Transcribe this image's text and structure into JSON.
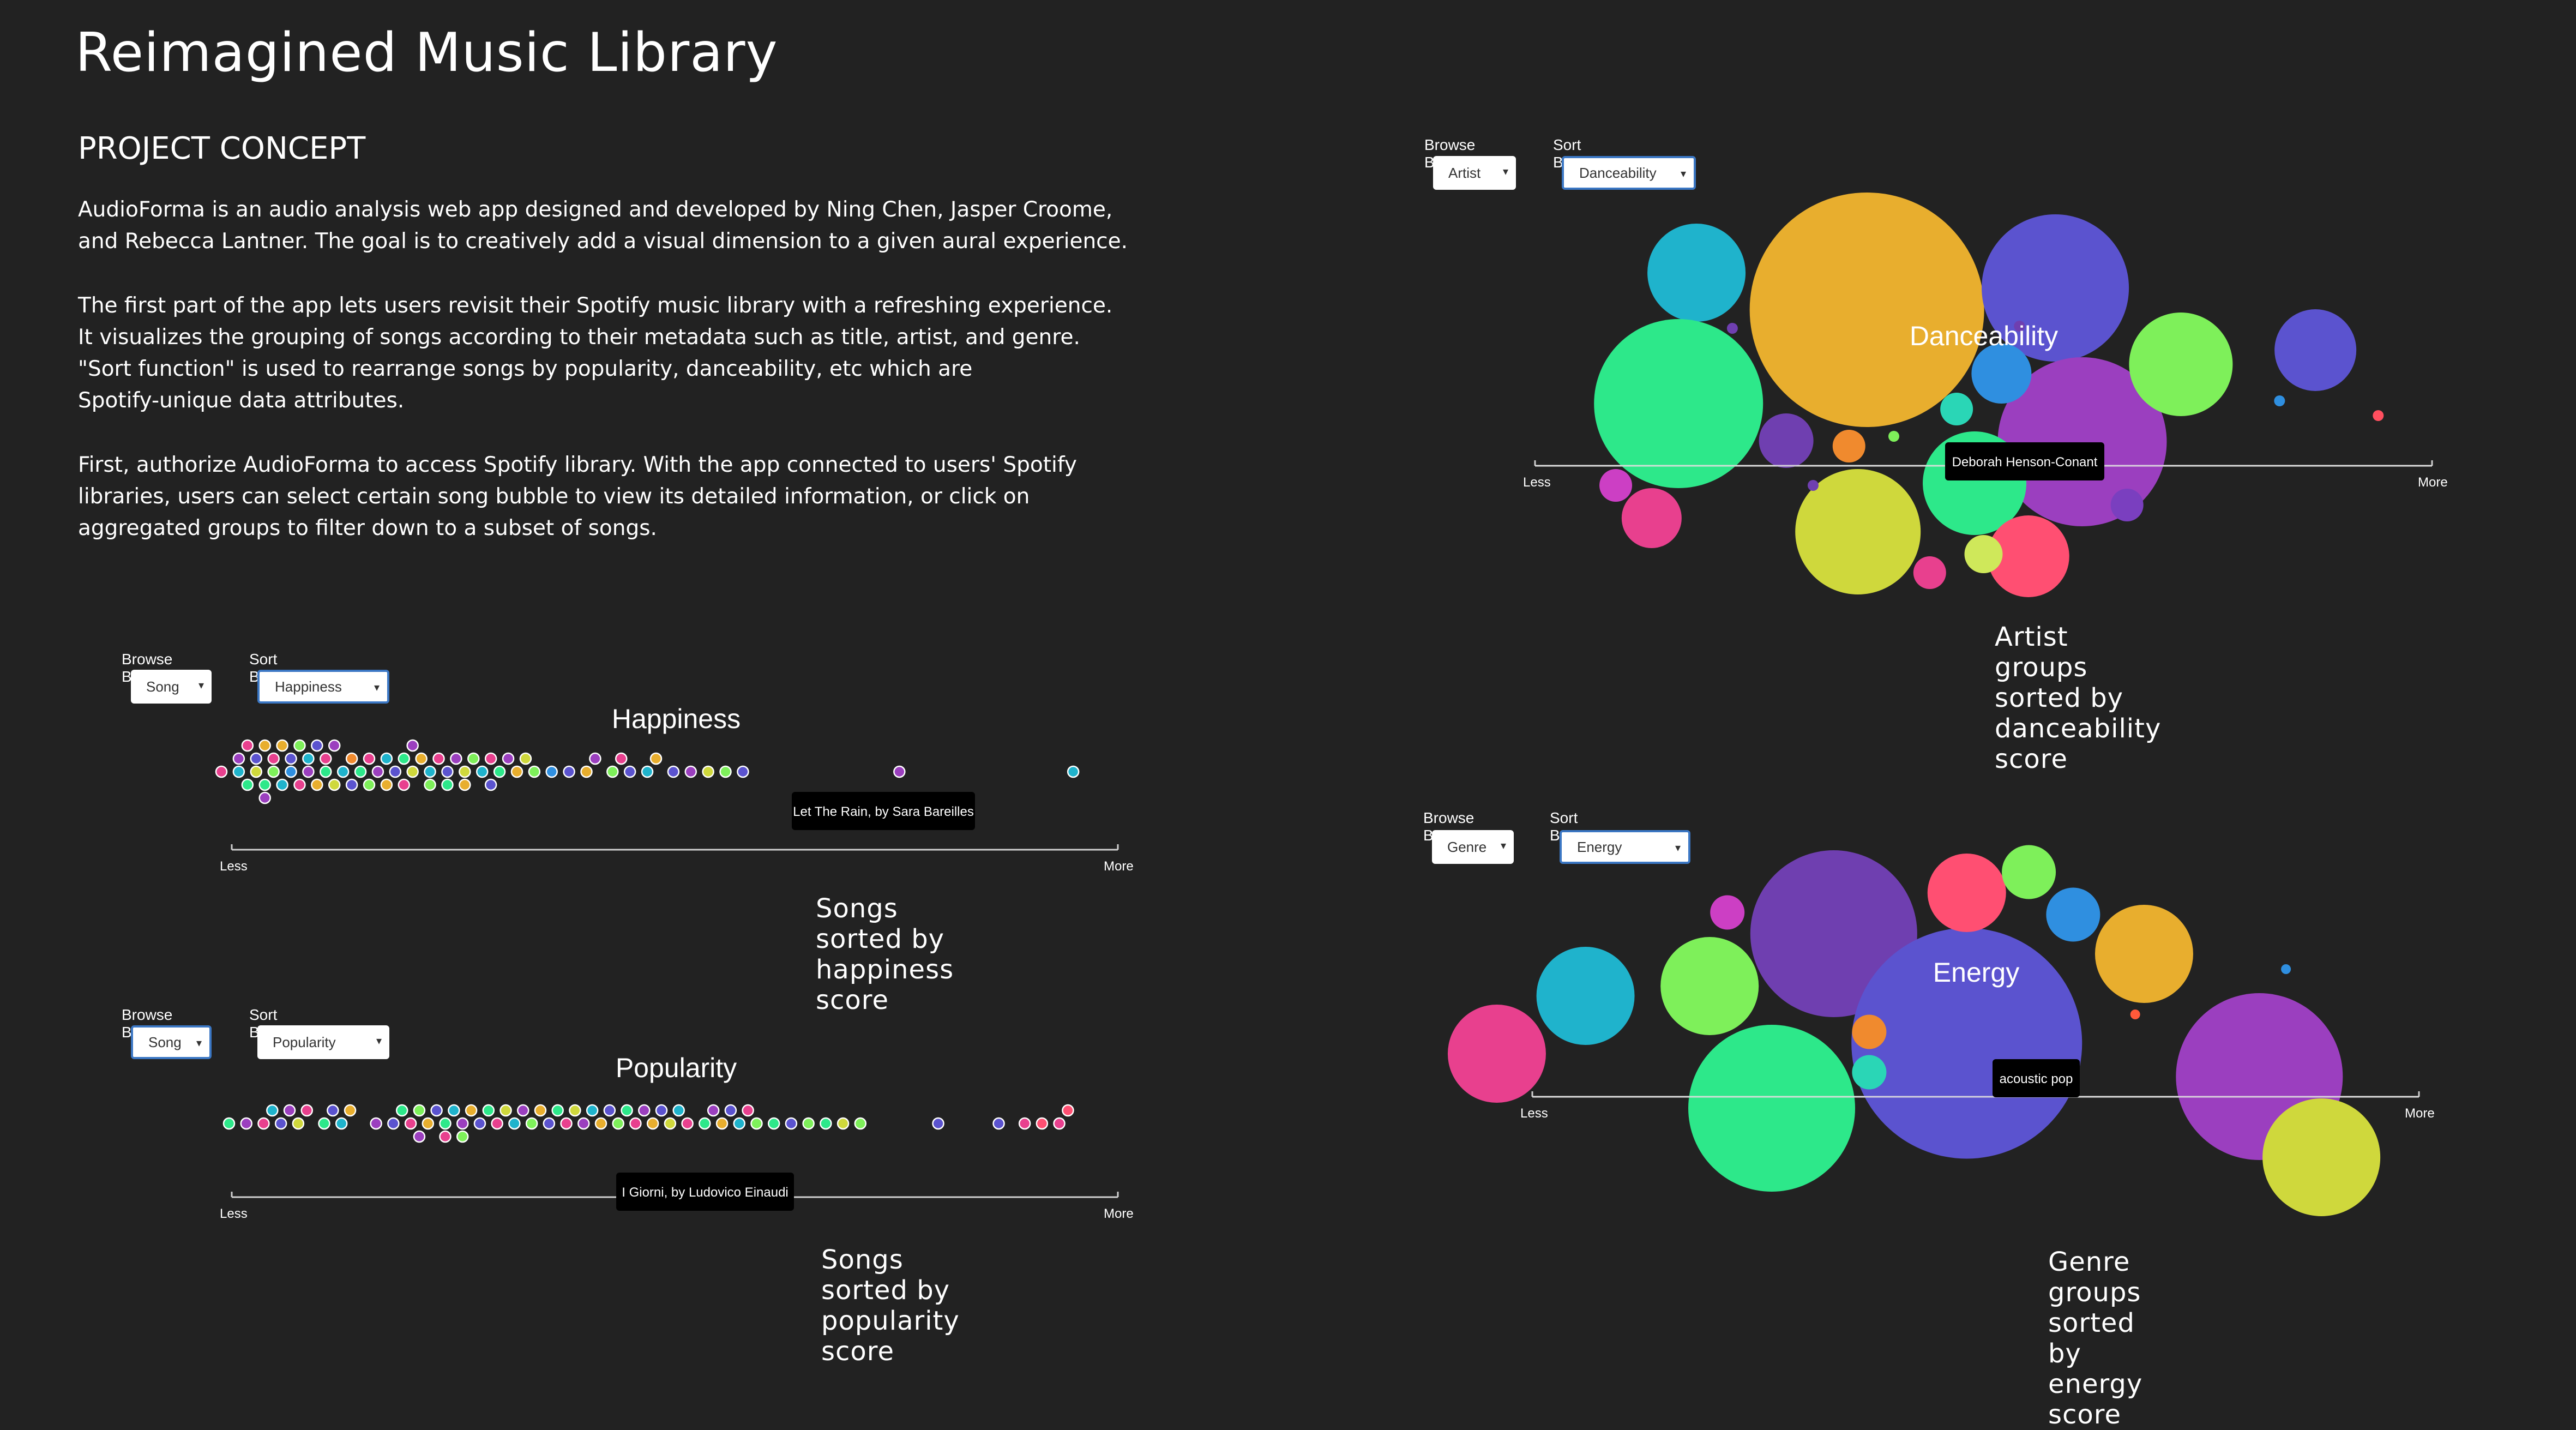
{
  "page": {
    "title": "Reimagined Music Library",
    "concept_heading": "PROJECT CONCEPT",
    "paragraphs": [
      [
        "AudioForma is an audio analysis web app designed and developed by Ning Chen, Jasper Croome,",
        "and Rebecca Lantner. The goal is to creatively add a visual dimension to a given aural experience."
      ],
      [
        "The first part of the app lets users revisit their Spotify music library with a refreshing experience.",
        "It visualizes the grouping of songs according to their metadata such as title, artist, and genre.",
        "\"Sort function\" is used to rearrange songs by popularity, danceability, etc which are",
        "Spotify-unique data attributes."
      ],
      [
        "First, authorize AudioForma to access Spotify library. With the app connected to users' Spotify",
        "libraries, users can select certain song bubble to view its detailed information, or click on",
        "aggregated groups to filter down to a subset of songs."
      ]
    ]
  },
  "panels": [
    {
      "id": "happiness",
      "browse_label": "Browse By",
      "browse_value": "Song",
      "sort_label": "Sort By",
      "sort_value": "Happiness",
      "sort_focused": true,
      "browse_focused": false,
      "chart_title": "Happiness",
      "tooltip": "Let The Rain, by Sara Bareilles",
      "axis_less": "Less",
      "axis_more": "More",
      "caption": "Songs sorted by happiness score"
    },
    {
      "id": "popularity",
      "browse_label": "Browse By",
      "browse_value": "Song",
      "sort_label": "Sort By",
      "sort_value": "Popularity",
      "sort_focused": false,
      "browse_focused": true,
      "chart_title": "Popularity",
      "tooltip": "I Giorni, by Ludovico Einaudi",
      "axis_less": "Less",
      "axis_more": "More",
      "caption": "Songs sorted by popularity score"
    },
    {
      "id": "danceability",
      "browse_label": "Browse By",
      "browse_value": "Artist",
      "sort_label": "Sort By",
      "sort_value": "Danceability",
      "sort_focused": true,
      "browse_focused": false,
      "chart_title": "Danceability",
      "tooltip": "Deborah Henson-Conant",
      "axis_less": "Less",
      "axis_more": "More",
      "caption": "Artist groups sorted by danceability score"
    },
    {
      "id": "energy",
      "browse_label": "Browse By",
      "browse_value": "Genre",
      "sort_label": "Sort By",
      "sort_value": "Energy",
      "sort_focused": true,
      "browse_focused": false,
      "chart_title": "Energy",
      "tooltip": "acoustic pop",
      "axis_less": "Less",
      "axis_more": "More",
      "caption": "Genre groups sorted by energy score"
    }
  ],
  "colors": {
    "background": "#222222",
    "focus_border": "#3b77c4",
    "palette": [
      "#e8408e",
      "#1fb3cc",
      "#2de88a",
      "#e8ae2e",
      "#5b53cf",
      "#9b3fbf",
      "#7ef05a",
      "#cfd83c",
      "#2f8fe0",
      "#f08a2e",
      "#ff4f72",
      "#2ad6b6",
      "#7a3fbf",
      "#6f3fb0",
      "#cc3fc4"
    ]
  },
  "chart_data": [
    {
      "type": "scatter",
      "title": "Happiness",
      "xlabel_left": "Less",
      "xlabel_right": "More",
      "note": "beeswarm of songs, x = happiness score (relative, Less to More)",
      "points": [
        [
          0.0,
          "#e8408e"
        ],
        [
          0.02,
          "#1fb3cc"
        ],
        [
          0.02,
          "#9b3fbf"
        ],
        [
          0.03,
          "#2de88a"
        ],
        [
          0.03,
          "#e8408e"
        ],
        [
          0.04,
          "#cfd83c"
        ],
        [
          0.04,
          "#5b53cf"
        ],
        [
          0.05,
          "#2de88a"
        ],
        [
          0.05,
          "#e8ae2e"
        ],
        [
          0.05,
          "#9b3fbf"
        ],
        [
          0.06,
          "#7ef05a"
        ],
        [
          0.06,
          "#e8408e"
        ],
        [
          0.07,
          "#1fb3cc"
        ],
        [
          0.07,
          "#e8ae2e"
        ],
        [
          0.08,
          "#2f8fe0"
        ],
        [
          0.08,
          "#5b53cf"
        ],
        [
          0.09,
          "#e8408e"
        ],
        [
          0.09,
          "#7ef05a"
        ],
        [
          0.1,
          "#9b3fbf"
        ],
        [
          0.1,
          "#1fb3cc"
        ],
        [
          0.11,
          "#e8ae2e"
        ],
        [
          0.11,
          "#5b53cf"
        ],
        [
          0.12,
          "#2de88a"
        ],
        [
          0.12,
          "#e8408e"
        ],
        [
          0.13,
          "#cfd83c"
        ],
        [
          0.13,
          "#9b3fbf"
        ],
        [
          0.14,
          "#1fb3cc"
        ],
        [
          0.15,
          "#f08a2e"
        ],
        [
          0.15,
          "#5b53cf"
        ],
        [
          0.16,
          "#2de88a"
        ],
        [
          0.17,
          "#e8408e"
        ],
        [
          0.17,
          "#7ef05a"
        ],
        [
          0.18,
          "#9b3fbf"
        ],
        [
          0.19,
          "#1fb3cc"
        ],
        [
          0.19,
          "#e8ae2e"
        ],
        [
          0.2,
          "#5b53cf"
        ],
        [
          0.21,
          "#2de88a"
        ],
        [
          0.21,
          "#e8408e"
        ],
        [
          0.22,
          "#cfd83c"
        ],
        [
          0.22,
          "#9b3fbf"
        ],
        [
          0.23,
          "#e8ae2e"
        ],
        [
          0.24,
          "#1fb3cc"
        ],
        [
          0.24,
          "#7ef05a"
        ],
        [
          0.25,
          "#e8408e"
        ],
        [
          0.26,
          "#5b53cf"
        ],
        [
          0.26,
          "#2de88a"
        ],
        [
          0.27,
          "#9b3fbf"
        ],
        [
          0.28,
          "#cfd83c"
        ],
        [
          0.28,
          "#e8ae2e"
        ],
        [
          0.29,
          "#7ef05a"
        ],
        [
          0.3,
          "#1fb3cc"
        ],
        [
          0.31,
          "#e8408e"
        ],
        [
          0.31,
          "#5b53cf"
        ],
        [
          0.32,
          "#2de88a"
        ],
        [
          0.33,
          "#9b3fbf"
        ],
        [
          0.34,
          "#e8ae2e"
        ],
        [
          0.35,
          "#cfd83c"
        ],
        [
          0.36,
          "#7ef05a"
        ],
        [
          0.38,
          "#2f8fe0"
        ],
        [
          0.4,
          "#5b53cf"
        ],
        [
          0.42,
          "#e8ae2e"
        ],
        [
          0.43,
          "#9b3fbf"
        ],
        [
          0.45,
          "#7ef05a"
        ],
        [
          0.46,
          "#e8408e"
        ],
        [
          0.47,
          "#5b53cf"
        ],
        [
          0.49,
          "#1fb3cc"
        ],
        [
          0.5,
          "#e8ae2e"
        ],
        [
          0.52,
          "#5b53cf"
        ],
        [
          0.54,
          "#9b3fbf"
        ],
        [
          0.56,
          "#cfd83c"
        ],
        [
          0.58,
          "#7ef05a"
        ],
        [
          0.6,
          "#5b53cf"
        ],
        [
          0.78,
          "#9b3fbf"
        ],
        [
          0.98,
          "#1fb3cc"
        ]
      ]
    },
    {
      "type": "scatter",
      "title": "Popularity",
      "xlabel_left": "Less",
      "xlabel_right": "More",
      "note": "beeswarm of songs, x = popularity score (relative, Less to More)",
      "points": [
        [
          0.0,
          "#2de88a"
        ],
        [
          0.02,
          "#9b3fbf"
        ],
        [
          0.04,
          "#e8408e"
        ],
        [
          0.05,
          "#1fb3cc"
        ],
        [
          0.06,
          "#5b53cf"
        ],
        [
          0.07,
          "#9b3fbf"
        ],
        [
          0.08,
          "#cfd83c"
        ],
        [
          0.09,
          "#e8408e"
        ],
        [
          0.11,
          "#2de88a"
        ],
        [
          0.12,
          "#5b53cf"
        ],
        [
          0.13,
          "#1fb3cc"
        ],
        [
          0.14,
          "#e8ae2e"
        ],
        [
          0.17,
          "#9b3fbf"
        ],
        [
          0.19,
          "#5b53cf"
        ],
        [
          0.2,
          "#2de88a"
        ],
        [
          0.21,
          "#e8408e"
        ],
        [
          0.22,
          "#7ef05a"
        ],
        [
          0.22,
          "#9b3fbf"
        ],
        [
          0.23,
          "#e8ae2e"
        ],
        [
          0.24,
          "#5b53cf"
        ],
        [
          0.25,
          "#2de88a"
        ],
        [
          0.25,
          "#e8408e"
        ],
        [
          0.26,
          "#1fb3cc"
        ],
        [
          0.27,
          "#9b3fbf"
        ],
        [
          0.27,
          "#7ef05a"
        ],
        [
          0.28,
          "#e8ae2e"
        ],
        [
          0.29,
          "#5b53cf"
        ],
        [
          0.3,
          "#2de88a"
        ],
        [
          0.31,
          "#e8408e"
        ],
        [
          0.32,
          "#cfd83c"
        ],
        [
          0.33,
          "#1fb3cc"
        ],
        [
          0.34,
          "#9b3fbf"
        ],
        [
          0.35,
          "#7ef05a"
        ],
        [
          0.36,
          "#e8ae2e"
        ],
        [
          0.37,
          "#5b53cf"
        ],
        [
          0.38,
          "#2de88a"
        ],
        [
          0.39,
          "#e8408e"
        ],
        [
          0.4,
          "#cfd83c"
        ],
        [
          0.41,
          "#9b3fbf"
        ],
        [
          0.42,
          "#1fb3cc"
        ],
        [
          0.43,
          "#e8ae2e"
        ],
        [
          0.44,
          "#5b53cf"
        ],
        [
          0.45,
          "#7ef05a"
        ],
        [
          0.46,
          "#2de88a"
        ],
        [
          0.47,
          "#e8408e"
        ],
        [
          0.48,
          "#9b3fbf"
        ],
        [
          0.49,
          "#e8ae2e"
        ],
        [
          0.5,
          "#5b53cf"
        ],
        [
          0.51,
          "#cfd83c"
        ],
        [
          0.52,
          "#1fb3cc"
        ],
        [
          0.53,
          "#e8408e"
        ],
        [
          0.55,
          "#2de88a"
        ],
        [
          0.56,
          "#9b3fbf"
        ],
        [
          0.57,
          "#e8ae2e"
        ],
        [
          0.58,
          "#5b53cf"
        ],
        [
          0.59,
          "#1fb3cc"
        ],
        [
          0.6,
          "#e8408e"
        ],
        [
          0.61,
          "#7ef05a"
        ],
        [
          0.63,
          "#2de88a"
        ],
        [
          0.65,
          "#5b53cf"
        ],
        [
          0.67,
          "#7ef05a"
        ],
        [
          0.69,
          "#2de88a"
        ],
        [
          0.71,
          "#cfd83c"
        ],
        [
          0.73,
          "#7ef05a"
        ],
        [
          0.82,
          "#5b53cf"
        ],
        [
          0.89,
          "#5b53cf"
        ],
        [
          0.92,
          "#e8408e"
        ],
        [
          0.94,
          "#ff4f72"
        ],
        [
          0.96,
          "#e8408e"
        ],
        [
          0.97,
          "#ff4f72"
        ]
      ]
    },
    {
      "type": "scatter",
      "title": "Danceability",
      "xlabel_left": "Less",
      "xlabel_right": "More",
      "note": "bubble chart of artist groups (relative x position and bubble size)",
      "bubbles": [
        {
          "x": 0.18,
          "size": 0.18,
          "color": "#1fb3cc"
        },
        {
          "x": 0.37,
          "size": 0.43,
          "color": "#e8ae2e"
        },
        {
          "x": 0.58,
          "size": 0.27,
          "color": "#5b53cf"
        },
        {
          "x": 0.16,
          "size": 0.31,
          "color": "#2de88a"
        },
        {
          "x": 0.61,
          "size": 0.31,
          "color": "#9b3fbf"
        },
        {
          "x": 0.72,
          "size": 0.19,
          "color": "#7ef05a"
        },
        {
          "x": 0.87,
          "size": 0.15,
          "color": "#5b53cf"
        },
        {
          "x": 0.36,
          "size": 0.23,
          "color": "#cfd83c"
        },
        {
          "x": 0.49,
          "size": 0.19,
          "color": "#2de88a"
        },
        {
          "x": 0.55,
          "size": 0.15,
          "color": "#ff4f72"
        },
        {
          "x": 0.52,
          "size": 0.11,
          "color": "#2f8fe0"
        },
        {
          "x": 0.28,
          "size": 0.1,
          "color": "#6f3fb0"
        },
        {
          "x": 0.13,
          "size": 0.11,
          "color": "#e8408e"
        },
        {
          "x": 0.09,
          "size": 0.06,
          "color": "#cc3fc4"
        },
        {
          "x": 0.35,
          "size": 0.06,
          "color": "#f08a2e"
        },
        {
          "x": 0.47,
          "size": 0.06,
          "color": "#2ad6b6"
        },
        {
          "x": 0.66,
          "size": 0.06,
          "color": "#7a3fbf"
        },
        {
          "x": 0.5,
          "size": 0.07,
          "color": "#cfe85a"
        },
        {
          "x": 0.44,
          "size": 0.06,
          "color": "#e8408e"
        },
        {
          "x": 0.4,
          "size": 0.02,
          "color": "#7ef05a"
        },
        {
          "x": 0.22,
          "size": 0.02,
          "color": "#6f3fb0"
        },
        {
          "x": 0.83,
          "size": 0.02,
          "color": "#2f8fe0"
        },
        {
          "x": 0.94,
          "size": 0.02,
          "color": "#ff4f5f"
        },
        {
          "x": 0.31,
          "size": 0.02,
          "color": "#6f3fb0"
        },
        {
          "x": 0.54,
          "size": 0.02,
          "color": "#6f3fb0"
        }
      ]
    },
    {
      "type": "scatter",
      "title": "Energy",
      "xlabel_left": "Less",
      "xlabel_right": "More",
      "note": "bubble chart of genre groups (relative x position and bubble size)",
      "bubbles": [
        {
          "x": -0.04,
          "size": 0.2,
          "color": "#e8408e"
        },
        {
          "x": 0.06,
          "size": 0.2,
          "color": "#1fb3cc"
        },
        {
          "x": 0.2,
          "size": 0.2,
          "color": "#7ef05a"
        },
        {
          "x": 0.34,
          "size": 0.34,
          "color": "#6f3fb0"
        },
        {
          "x": 0.27,
          "size": 0.34,
          "color": "#2de88a"
        },
        {
          "x": 0.49,
          "size": 0.47,
          "color": "#5b53cf"
        },
        {
          "x": 0.49,
          "size": 0.16,
          "color": "#ff4f72"
        },
        {
          "x": 0.56,
          "size": 0.11,
          "color": "#7ef05a"
        },
        {
          "x": 0.61,
          "size": 0.11,
          "color": "#2f8fe0"
        },
        {
          "x": 0.69,
          "size": 0.2,
          "color": "#e8ae2e"
        },
        {
          "x": 0.82,
          "size": 0.34,
          "color": "#9b3fbf"
        },
        {
          "x": 0.89,
          "size": 0.24,
          "color": "#cfd83c"
        },
        {
          "x": 0.38,
          "size": 0.07,
          "color": "#f08a2e"
        },
        {
          "x": 0.38,
          "size": 0.07,
          "color": "#2ad6b6"
        },
        {
          "x": 0.22,
          "size": 0.07,
          "color": "#cc3fc4"
        },
        {
          "x": 0.85,
          "size": 0.02,
          "color": "#2f8fe0"
        },
        {
          "x": 0.68,
          "size": 0.02,
          "color": "#ff5a3a"
        }
      ]
    }
  ]
}
